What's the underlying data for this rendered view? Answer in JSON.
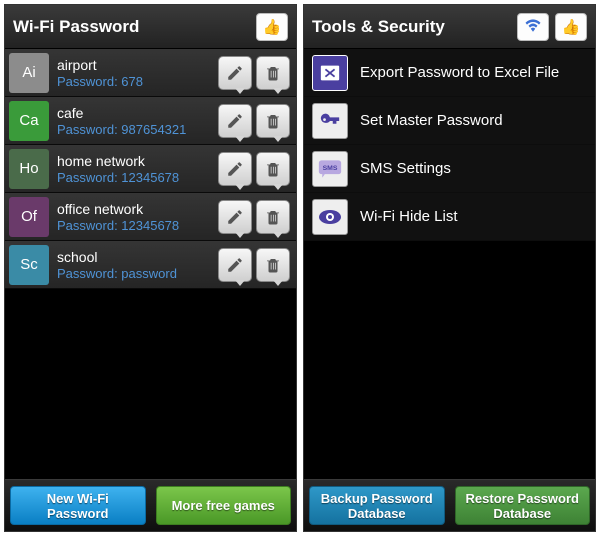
{
  "left": {
    "title": "Wi-Fi Password",
    "items": [
      {
        "abbr": "Ai",
        "color": "#8c8c8c",
        "name": "airport",
        "password": "Password: 678"
      },
      {
        "abbr": "Ca",
        "color": "#3a9b3a",
        "name": "cafe",
        "password": "Password: 987654321"
      },
      {
        "abbr": "Ho",
        "color": "#4a6b4a",
        "name": "home network",
        "password": "Password: 12345678"
      },
      {
        "abbr": "Of",
        "color": "#6a3a6a",
        "name": "office network",
        "password": "Password: 12345678"
      },
      {
        "abbr": "Sc",
        "color": "#3a8ba6",
        "name": "school",
        "password": "Password: password"
      }
    ],
    "footer": {
      "left": "New Wi-Fi Password",
      "right": "More free games"
    }
  },
  "right": {
    "title": "Tools & Security",
    "items": [
      {
        "icon": "excel",
        "label": "Export Password to Excel File"
      },
      {
        "icon": "key",
        "label": "Set Master Password"
      },
      {
        "icon": "sms",
        "label": "SMS Settings"
      },
      {
        "icon": "eye",
        "label": "Wi-Fi Hide List"
      }
    ],
    "footer": {
      "left": "Backup Password Database",
      "right": "Restore Password Database"
    }
  }
}
